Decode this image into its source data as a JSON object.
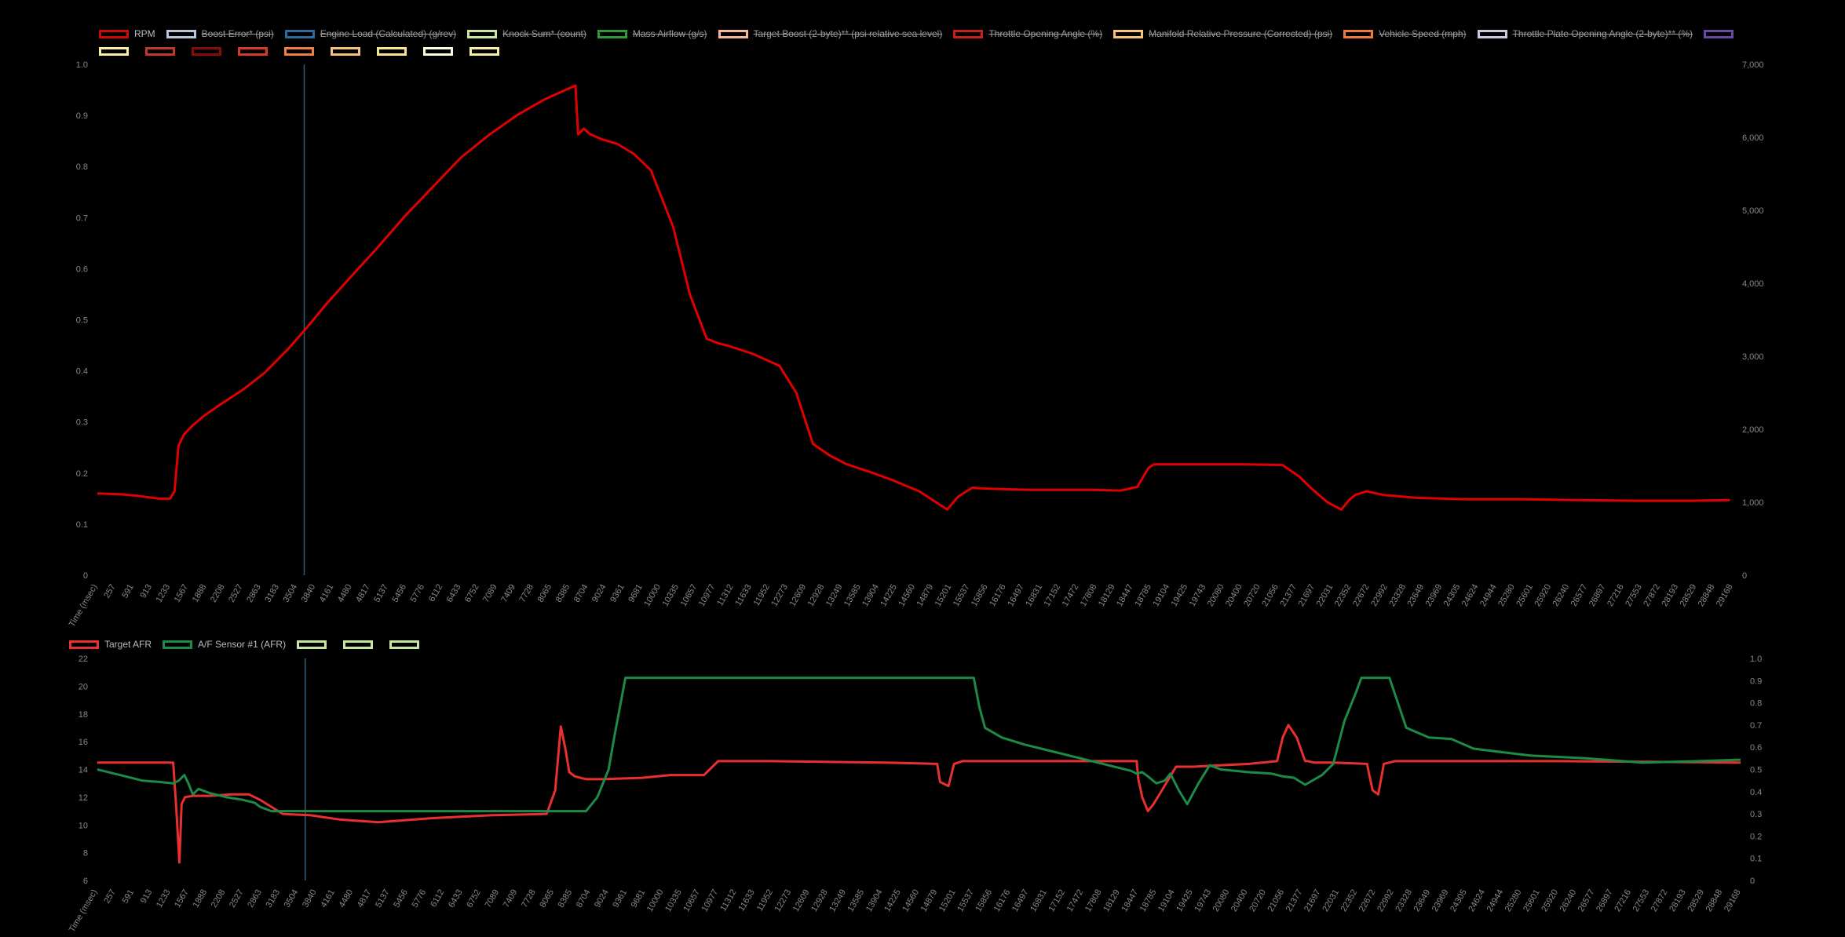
{
  "legend_top": [
    {
      "label": "RPM",
      "color": "#cc0a0a",
      "hidden": false
    },
    {
      "label": "Boost Error* (psi)",
      "color": "#b8c4d8",
      "hidden": true
    },
    {
      "label": "Engine Load (Calculated) (g/rev)",
      "color": "#2f6a9c",
      "hidden": true
    },
    {
      "label": "Knock Sum* (count)",
      "color": "#c8e6a0",
      "hidden": true
    },
    {
      "label": "Mass Airflow (g/s)",
      "color": "#2f9a3c",
      "hidden": true
    },
    {
      "label": "Target Boost (2-byte)** (psi relative sea level)",
      "color": "#f4b79a",
      "hidden": true
    },
    {
      "label": "Throttle Opening Angle (%)",
      "color": "#c81f1f",
      "hidden": true
    },
    {
      "label": "Manifold Relative Pressure (Corrected) (psi)",
      "color": "#f6c27a",
      "hidden": true
    },
    {
      "label": "Vehicle Speed (mph)",
      "color": "#f07a3a",
      "hidden": true
    },
    {
      "label": "Throttle Plate Opening Angle (2-byte)** (%)",
      "color": "#c8c8e0",
      "hidden": true
    },
    {
      "label": "",
      "color": "#6a4aa0",
      "hidden": true
    },
    {
      "label": "",
      "color": "#f6f0a0",
      "hidden": true
    },
    {
      "label": "",
      "color": "#c0392b",
      "hidden": true
    },
    {
      "label": "",
      "color": "#8b0a0a",
      "hidden": true
    },
    {
      "label": "",
      "color": "#d83a2a",
      "hidden": true
    },
    {
      "label": "",
      "color": "#f08040",
      "hidden": true
    },
    {
      "label": "",
      "color": "#f6c27a",
      "hidden": true
    },
    {
      "label": "",
      "color": "#f6e890",
      "hidden": true
    },
    {
      "label": "",
      "color": "#fffbe0",
      "hidden": true
    },
    {
      "label": "",
      "color": "#f6f0a0",
      "hidden": true
    }
  ],
  "legend_bottom": [
    {
      "label": "Target AFR",
      "color": "#e83030",
      "hidden": false
    },
    {
      "label": "A/F Sensor #1 (AFR)",
      "color": "#1e8a48",
      "hidden": false
    },
    {
      "label": "",
      "color": "#c8e6a0",
      "hidden": true
    },
    {
      "label": "",
      "color": "#c8e6a0",
      "hidden": true
    },
    {
      "label": "",
      "color": "#c8e6a0",
      "hidden": true
    }
  ],
  "x_tick_labels": [
    "Time (msec)",
    "257",
    "591",
    "913",
    "1233",
    "1567",
    "1888",
    "2208",
    "2527",
    "2863",
    "3183",
    "3504",
    "3840",
    "4161",
    "4480",
    "4817",
    "5137",
    "5456",
    "5776",
    "6112",
    "6433",
    "6752",
    "7089",
    "7409",
    "7728",
    "8065",
    "8385",
    "8704",
    "9024",
    "9361",
    "9681",
    "10000",
    "10335",
    "10657",
    "10977",
    "11312",
    "11633",
    "11952",
    "12273",
    "12609",
    "12928",
    "13249",
    "13585",
    "13904",
    "14225",
    "14560",
    "14879",
    "15201",
    "15537",
    "15856",
    "16176",
    "16497",
    "16831",
    "17152",
    "17472",
    "17808",
    "18129",
    "18447",
    "18785",
    "19104",
    "19425",
    "19743",
    "20080",
    "20400",
    "20720",
    "21056",
    "21377",
    "21697",
    "22031",
    "22352",
    "22672",
    "22992",
    "23328",
    "23649",
    "23969",
    "24305",
    "24624",
    "24944",
    "25280",
    "25601",
    "25920",
    "26240",
    "26577",
    "26897",
    "27216",
    "27553",
    "27872",
    "28193",
    "28529",
    "28848",
    "29168"
  ],
  "chart_data": [
    {
      "type": "line",
      "x_range": [
        0,
        29250
      ],
      "cursor_x": 3700,
      "y_left": {
        "range": [
          0,
          1
        ],
        "ticks": [
          "0",
          "0.1",
          "0.2",
          "0.3",
          "0.4",
          "0.5",
          "0.6",
          "0.7",
          "0.8",
          "0.9",
          "1.0"
        ]
      },
      "y_right": {
        "range": [
          0,
          7000
        ],
        "ticks": [
          "0",
          "1,000",
          "2,000",
          "3,000",
          "4,000",
          "5,000",
          "6,000",
          "7,000"
        ]
      },
      "series": [
        {
          "name": "RPM",
          "axis": "right",
          "color": "#e00000",
          "x": [
            0,
            400,
            700,
            900,
            1100,
            1300,
            1380,
            1450,
            1550,
            1700,
            1900,
            2200,
            2600,
            3000,
            3400,
            3700,
            4100,
            4500,
            5000,
            5500,
            6000,
            6500,
            7000,
            7500,
            8000,
            8550,
            8600,
            8700,
            8800,
            9000,
            9300,
            9600,
            9900,
            10300,
            10600,
            10900,
            11100,
            11300,
            11700,
            12200,
            12500,
            12800,
            13100,
            13400,
            13800,
            14200,
            14700,
            15000,
            15200,
            15400,
            15650,
            15800,
            16200,
            16700,
            17200,
            17800,
            18300,
            18600,
            18800,
            18900,
            19100,
            19500,
            20500,
            21200,
            21500,
            21700,
            22000,
            22250,
            22400,
            22500,
            22700,
            23000,
            23600,
            24500,
            25500,
            26500,
            27500,
            28500,
            29200
          ],
          "y": [
            1120,
            1110,
            1090,
            1070,
            1050,
            1050,
            1150,
            1770,
            1930,
            2050,
            2180,
            2340,
            2540,
            2780,
            3090,
            3350,
            3720,
            4060,
            4480,
            4920,
            5320,
            5720,
            6030,
            6300,
            6520,
            6710,
            6040,
            6120,
            6050,
            5980,
            5910,
            5770,
            5550,
            4770,
            3840,
            3240,
            3180,
            3140,
            3040,
            2870,
            2500,
            1800,
            1640,
            1520,
            1420,
            1310,
            1150,
            1000,
            900,
            1080,
            1200,
            1190,
            1180,
            1170,
            1170,
            1170,
            1160,
            1210,
            1470,
            1520,
            1520,
            1520,
            1520,
            1510,
            1350,
            1200,
            1000,
            900,
            1040,
            1100,
            1150,
            1100,
            1060,
            1040,
            1040,
            1030,
            1020,
            1020,
            1030
          ]
        }
      ]
    },
    {
      "type": "line",
      "x_range": [
        0,
        29250
      ],
      "cursor_x": 3700,
      "y_left": {
        "range": [
          6,
          22
        ],
        "ticks": [
          "6",
          "8",
          "10",
          "12",
          "14",
          "16",
          "18",
          "20",
          "22"
        ]
      },
      "y_right": {
        "range": [
          0,
          1
        ],
        "ticks": [
          "0",
          "0.1",
          "0.2",
          "0.3",
          "0.4",
          "0.5",
          "0.6",
          "0.7",
          "0.8",
          "0.9",
          "1.0"
        ]
      },
      "series": [
        {
          "name": "Target AFR",
          "axis": "left",
          "color": "#e83030",
          "x": [
            0,
            1350,
            1400,
            1460,
            1500,
            1560,
            1700,
            2000,
            2400,
            2700,
            2900,
            3300,
            3800,
            4300,
            5000,
            6000,
            7000,
            8000,
            8150,
            8250,
            8330,
            8400,
            8500,
            8700,
            9000,
            9700,
            10200,
            10800,
            11000,
            11050,
            12000,
            14000,
            14950,
            15000,
            15150,
            15250,
            15400,
            18500,
            18530,
            18600,
            18700,
            18800,
            18950,
            19200,
            19500,
            20500,
            21000,
            21100,
            21200,
            21350,
            21500,
            21550,
            21650,
            22000,
            22600,
            22700,
            22800,
            22900,
            23100,
            26000,
            29250
          ],
          "y": [
            14.5,
            14.5,
            11.5,
            7.3,
            11.5,
            12.0,
            12.1,
            12.1,
            12.2,
            12.2,
            11.8,
            10.8,
            10.7,
            10.4,
            10.2,
            10.5,
            10.7,
            10.8,
            12.5,
            17.1,
            15.5,
            13.8,
            13.5,
            13.3,
            13.3,
            13.4,
            13.6,
            13.6,
            14.4,
            14.6,
            14.6,
            14.5,
            14.4,
            13.1,
            12.8,
            14.4,
            14.6,
            14.6,
            13.3,
            12.0,
            11.0,
            11.5,
            12.5,
            14.2,
            14.2,
            14.4,
            14.6,
            16.3,
            17.2,
            16.3,
            14.6,
            14.6,
            14.5,
            14.5,
            14.4,
            12.5,
            12.2,
            14.4,
            14.6,
            14.6,
            14.5
          ]
        },
        {
          "name": "A/F Sensor #1 (AFR)",
          "axis": "left",
          "color": "#1e8a48",
          "x": [
            0,
            500,
            800,
            1100,
            1350,
            1450,
            1550,
            1620,
            1700,
            1800,
            2000,
            2300,
            2600,
            2800,
            2900,
            3100,
            3500,
            5000,
            7000,
            8300,
            8500,
            8700,
            8900,
            9100,
            9200,
            9400,
            10500,
            12000,
            14000,
            15600,
            15700,
            15800,
            16100,
            16500,
            17000,
            17500,
            18000,
            18400,
            18500,
            18600,
            18700,
            18850,
            19000,
            19100,
            19250,
            19400,
            19600,
            19800,
            20000,
            20500,
            20900,
            21100,
            21300,
            21500,
            21800,
            22000,
            22200,
            22400,
            22500,
            22700,
            23000,
            23300,
            23700,
            24100,
            24500,
            25500,
            26500,
            27500,
            28500,
            29250
          ],
          "y": [
            14.0,
            13.5,
            13.2,
            13.1,
            13.0,
            13.2,
            13.6,
            13.0,
            12.2,
            12.6,
            12.3,
            12.0,
            11.8,
            11.6,
            11.3,
            11.0,
            11.0,
            11.0,
            11.0,
            11.0,
            11.0,
            11.0,
            12.0,
            14.0,
            16.3,
            20.6,
            20.6,
            20.6,
            20.6,
            20.6,
            18.5,
            17.0,
            16.3,
            15.8,
            15.3,
            14.8,
            14.3,
            13.9,
            13.7,
            13.8,
            13.5,
            13.0,
            13.2,
            13.7,
            12.5,
            11.5,
            13.0,
            14.3,
            14.0,
            13.8,
            13.7,
            13.5,
            13.4,
            12.9,
            13.6,
            14.4,
            17.5,
            19.5,
            20.6,
            20.6,
            20.6,
            17.0,
            16.3,
            16.2,
            15.5,
            15.0,
            14.8,
            14.5,
            14.6,
            14.7
          ]
        }
      ]
    }
  ]
}
